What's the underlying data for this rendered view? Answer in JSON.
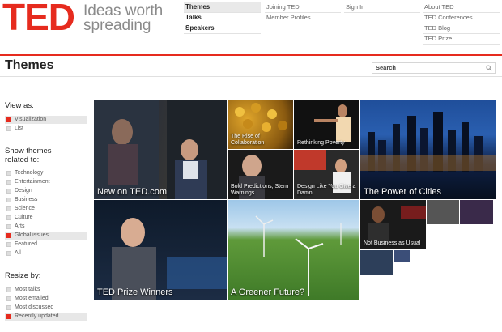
{
  "brand": {
    "logo": "TED",
    "tagline_line1": "Ideas worth",
    "tagline_line2": "spreading"
  },
  "colors": {
    "accent": "#e62b1e",
    "selected_box": "#e62b1e"
  },
  "nav": {
    "main": [
      {
        "label": "Themes",
        "active": true
      },
      {
        "label": "Talks",
        "active": false
      },
      {
        "label": "Speakers",
        "active": false
      }
    ],
    "col2": [
      "Joining TED",
      "Member Profiles"
    ],
    "col3": [
      "Sign In"
    ],
    "col4": [
      "About TED",
      "TED Conferences",
      "TED Blog",
      "TED Prize"
    ]
  },
  "page_title": "Themes",
  "search": {
    "placeholder": "Search"
  },
  "sidebar": {
    "view_as": {
      "heading": "View as:",
      "options": [
        {
          "label": "Visualization",
          "selected": true
        },
        {
          "label": "List",
          "selected": false
        }
      ]
    },
    "themes": {
      "heading_line1": "Show themes",
      "heading_line2": "related to:",
      "options": [
        {
          "label": "Technology",
          "selected": false
        },
        {
          "label": "Entertainment",
          "selected": false
        },
        {
          "label": "Design",
          "selected": false
        },
        {
          "label": "Business",
          "selected": false
        },
        {
          "label": "Science",
          "selected": false
        },
        {
          "label": "Culture",
          "selected": false
        },
        {
          "label": "Arts",
          "selected": false
        },
        {
          "label": "Global issues",
          "selected": true
        },
        {
          "label": "Featured",
          "selected": false
        },
        {
          "label": "All",
          "selected": false
        }
      ]
    },
    "resize": {
      "heading": "Resize by:",
      "options": [
        {
          "label": "Most talks",
          "selected": false
        },
        {
          "label": "Most emailed",
          "selected": false
        },
        {
          "label": "Most discussed",
          "selected": false
        },
        {
          "label": "Recently updated",
          "selected": true
        }
      ]
    }
  },
  "tiles": {
    "new_on_ted": "New on TED.com",
    "collaboration": "The Rise of Collaboration",
    "poverty": "Rethinking Poverty",
    "cities": "The Power of Cities",
    "predictions": "Bold Predictions, Stern Warnings",
    "design_damn": "Design Like You Give a Damn",
    "prize": "TED Prize Winners",
    "greener": "A Greener Future?",
    "not_business": "Not Business as Usual"
  }
}
